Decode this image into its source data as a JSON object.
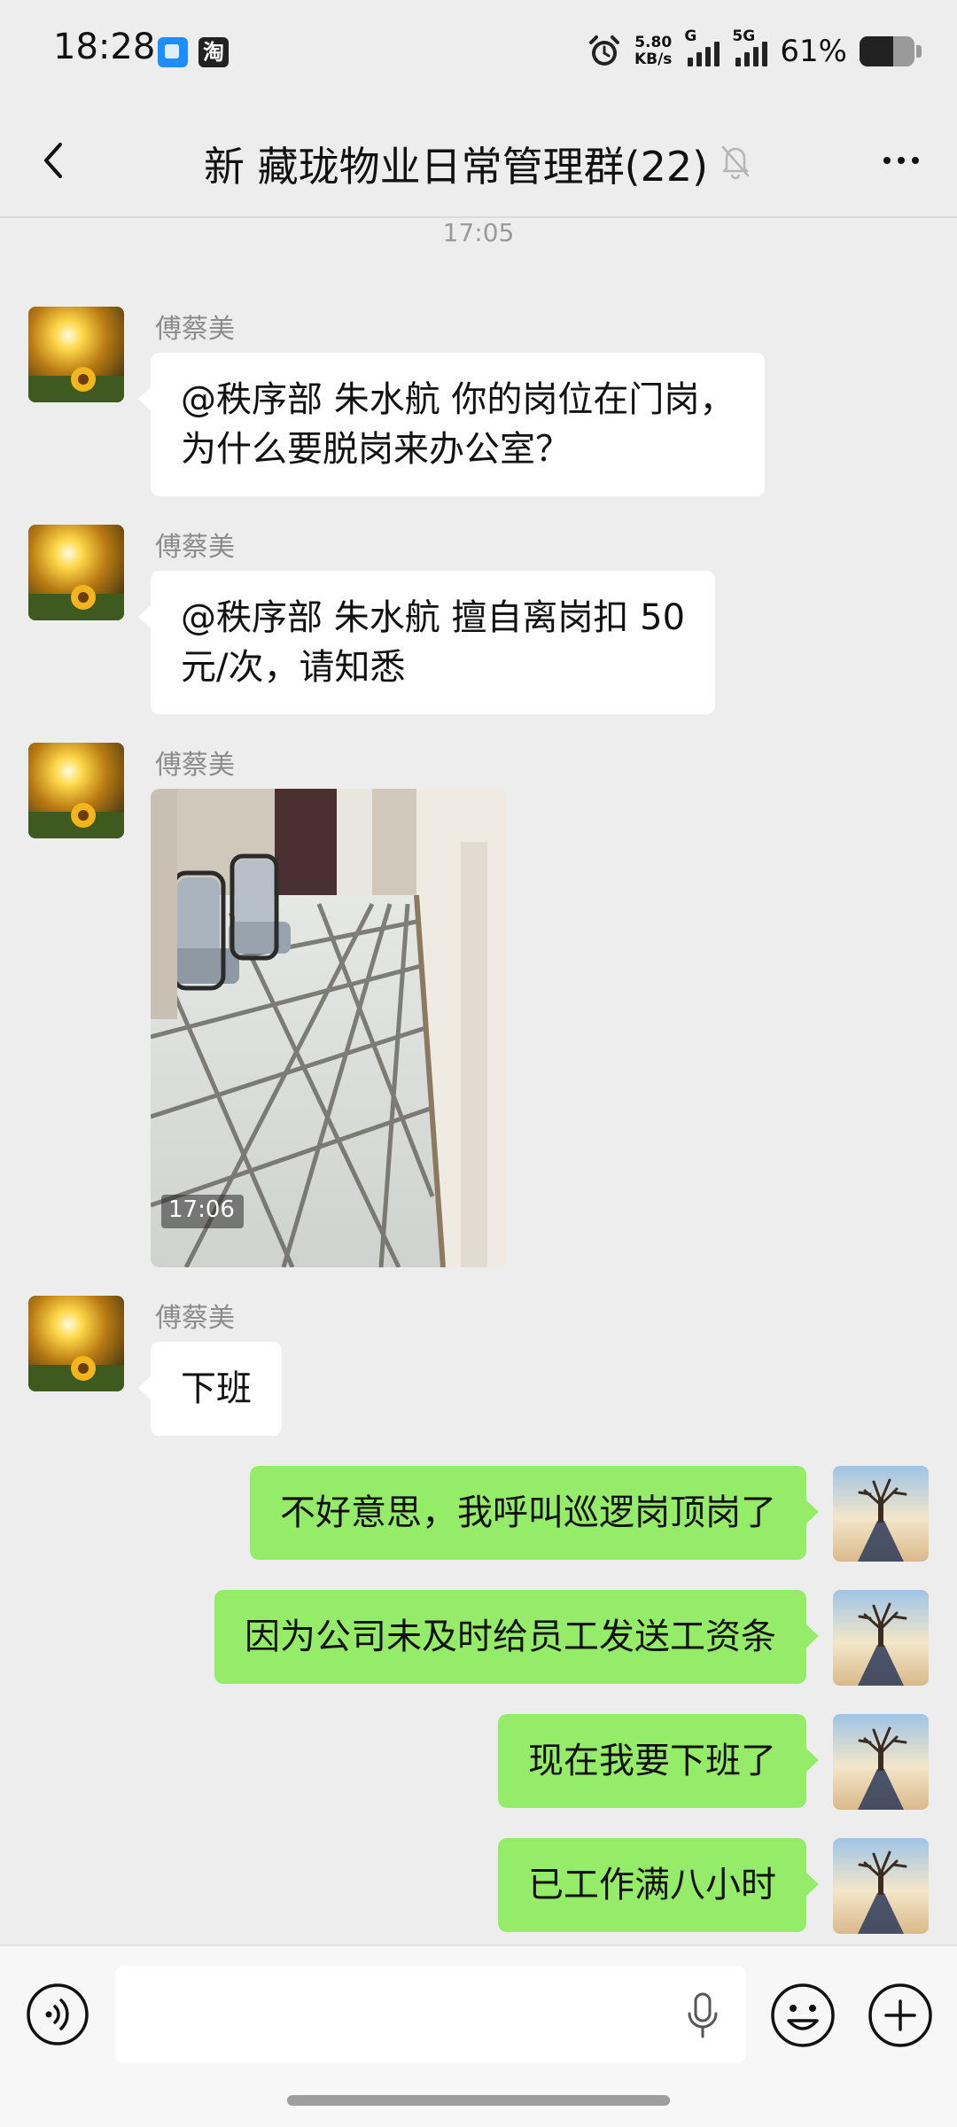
{
  "status_bar": {
    "time": "18:28",
    "net_speed_value": "5.80",
    "net_speed_unit": "KB/s",
    "sim1_tag": "G",
    "sim2_tag": "5G",
    "battery_percent": "61%",
    "battery_level": 0.61,
    "taobao_icon_text": "淘"
  },
  "header": {
    "title": "新 藏珑物业日常管理群(22)",
    "muted": true
  },
  "chat": {
    "timestamp": "17:05",
    "messages": [
      {
        "sender": "傅蔡美",
        "direction": "incoming",
        "type": "text",
        "lines": [
          "@秩序部 朱水航  你的岗位在门岗，",
          "为什么要脱岗来办公室？"
        ]
      },
      {
        "sender": "傅蔡美",
        "direction": "incoming",
        "type": "text",
        "lines": [
          "@秩序部 朱水航  擅自离岗扣 50",
          "元/次，请知悉"
        ]
      },
      {
        "sender": "傅蔡美",
        "direction": "incoming",
        "type": "image",
        "image_caption": "17:06"
      },
      {
        "sender": "傅蔡美",
        "direction": "incoming",
        "type": "text",
        "lines": [
          "下班"
        ]
      },
      {
        "direction": "outgoing",
        "type": "text",
        "lines": [
          "不好意思，我呼叫巡逻岗顶岗了"
        ]
      },
      {
        "direction": "outgoing",
        "type": "text",
        "lines": [
          "因为公司未及时给员工发送工资条"
        ]
      },
      {
        "direction": "outgoing",
        "type": "text",
        "lines": [
          "现在我要下班了"
        ]
      },
      {
        "direction": "outgoing",
        "type": "text",
        "lines": [
          "已工作满八小时"
        ]
      }
    ]
  },
  "input_bar": {
    "placeholder": "",
    "value": ""
  },
  "icons": {
    "back": "chevron-left-icon",
    "mute": "bell-off-icon",
    "more": "more-dots-icon",
    "voice": "voice-input-icon",
    "mic": "microphone-icon",
    "emoji": "emoji-icon",
    "plus": "plus-icon"
  },
  "colors": {
    "background": "#ededed",
    "incoming_bubble": "#ffffff",
    "outgoing_bubble": "#95ec69",
    "sender_name": "#8c8c8c"
  }
}
